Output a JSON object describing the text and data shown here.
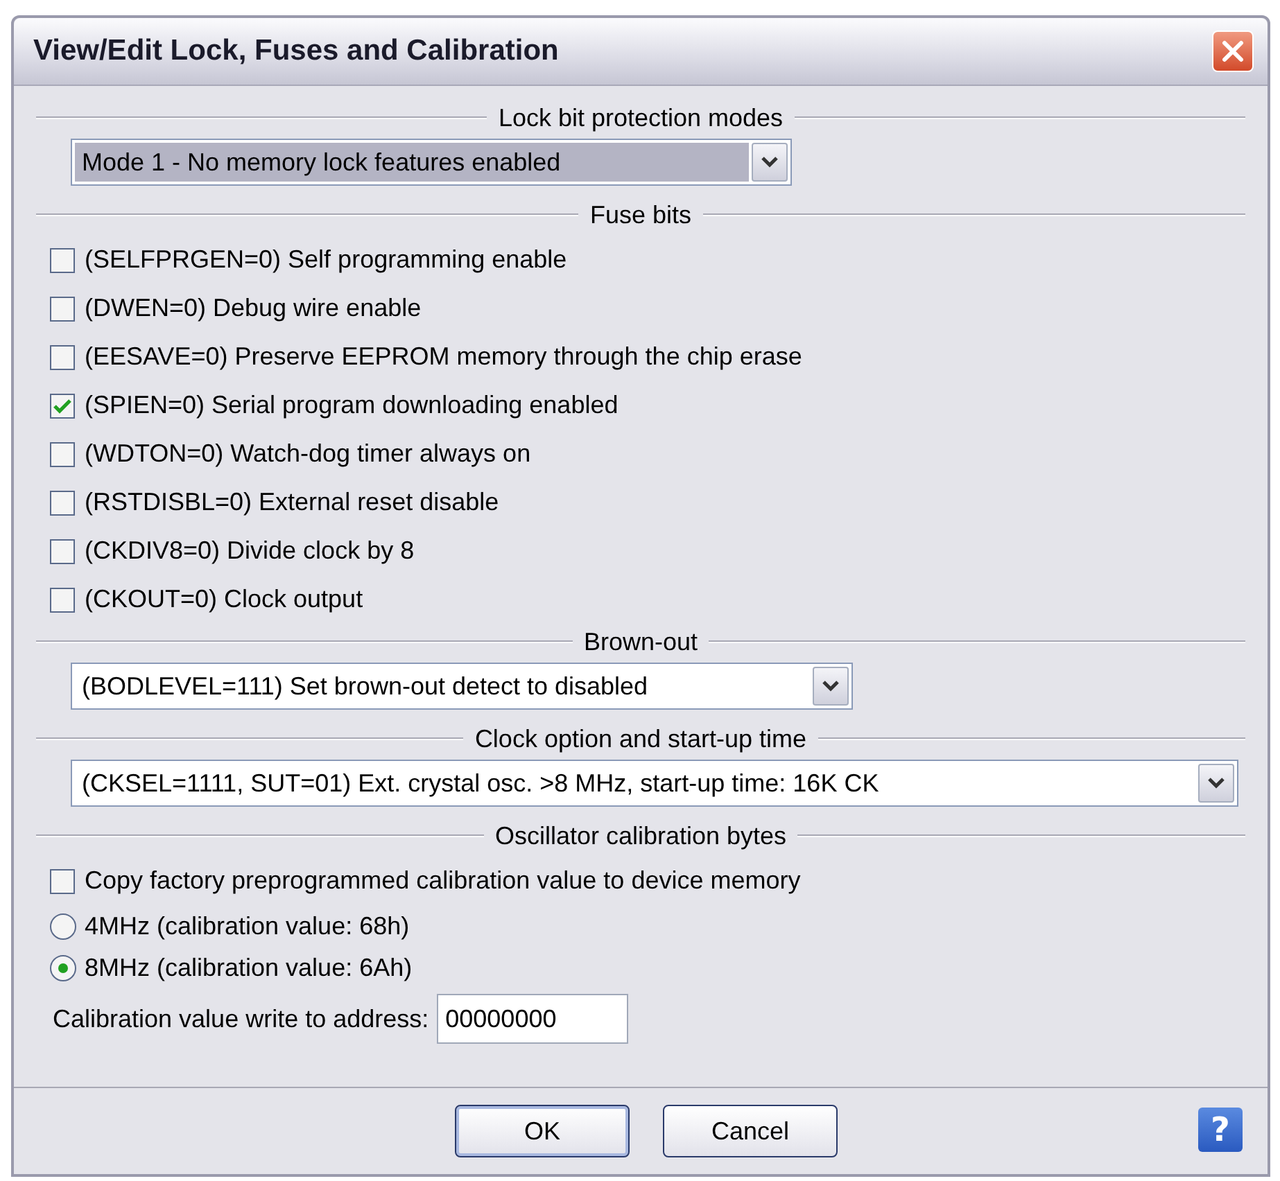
{
  "window": {
    "title": "View/Edit Lock, Fuses and Calibration"
  },
  "lock_bits": {
    "title": "Lock bit protection modes",
    "dropdown": {
      "value": "Mode 1 - No memory lock features enabled",
      "highlighted": true
    }
  },
  "fuse_bits": {
    "title": "Fuse bits",
    "options": [
      {
        "label": "(SELFPRGEN=0) Self programming enable",
        "checked": false
      },
      {
        "label": "(DWEN=0) Debug wire enable",
        "checked": false
      },
      {
        "label": "(EESAVE=0) Preserve EEPROM memory through the chip erase",
        "checked": false
      },
      {
        "label": "(SPIEN=0) Serial program downloading enabled",
        "checked": true
      },
      {
        "label": "(WDTON=0) Watch-dog timer always on",
        "checked": false
      },
      {
        "label": "(RSTDISBL=0) External reset disable",
        "checked": false
      },
      {
        "label": "(CKDIV8=0) Divide clock by 8",
        "checked": false
      },
      {
        "label": "(CKOUT=0) Clock output",
        "checked": false
      }
    ]
  },
  "brown_out": {
    "title": "Brown-out",
    "dropdown": {
      "value": "(BODLEVEL=111) Set brown-out detect to disabled",
      "highlighted": false
    }
  },
  "clock_option": {
    "title": "Clock option and start-up time",
    "dropdown": {
      "value": "(CKSEL=1111, SUT=01) Ext. crystal osc. >8 MHz, start-up time: 16K CK",
      "highlighted": false
    }
  },
  "calibration": {
    "title": "Oscillator calibration bytes",
    "copy_option": {
      "label": "Copy factory preprogrammed calibration value to device memory",
      "checked": false
    },
    "frequencies": [
      {
        "label": "4MHz (calibration value: 68h)",
        "selected": false
      },
      {
        "label": "8MHz (calibration value: 6Ah)",
        "selected": true
      }
    ],
    "address": {
      "label": "Calibration value write to address:",
      "value": "00000000"
    }
  },
  "buttons": [
    {
      "label": "OK",
      "default": true
    },
    {
      "label": "Cancel",
      "default": false
    }
  ],
  "help": {
    "label": "?"
  }
}
